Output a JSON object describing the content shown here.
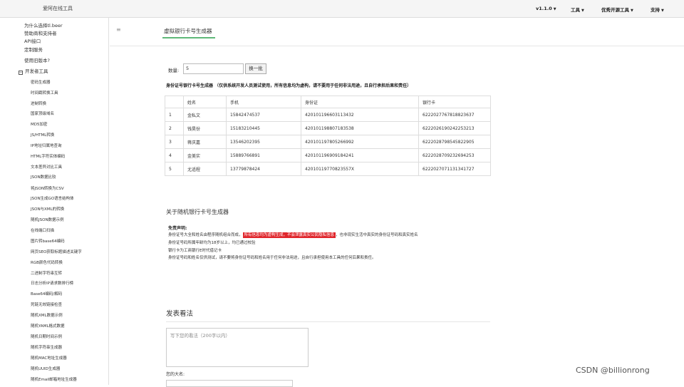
{
  "topbar": {
    "brand": "爱阿在线工具",
    "version": "v1.1.0",
    "tools": "工具",
    "open_source": "优秀开源工具",
    "support": "支持"
  },
  "sidebar": {
    "top_links": [
      "为什么选择tl.beer",
      "赞助商和支持者",
      "API接口",
      "定制服务",
      "使用旧版本?"
    ],
    "group_label": "开发者工具",
    "items": [
      "密码生成器",
      "时间戳转换工具",
      "进制转换",
      "国家顶级域名",
      "MD5加密",
      "JS/HTML转换",
      "IP地址归属地查询",
      "HTML字符实体编码",
      "文本差异对比工具",
      "JSON数据比较",
      "将JSON转换为CSV",
      "JSON生成GO语言结构体",
      "JSON与XML的转换",
      "随机JSON数据示例",
      "在线端口扫描",
      "图片转base64编码",
      "网页SEO获取标题描述关键字",
      "RGB颜色代码转换",
      "二进制字符串互转",
      "日志分析IP请求数排行榜",
      "Base64编码/解码",
      "死链无效链接检查",
      "随机XML数据示例",
      "随机YAML格式数据",
      "随机日期时间示例",
      "随机字符串生成器",
      "随机MAC地址生成器",
      "随机UUID生成器",
      "随机Email邮箱地址生成器"
    ]
  },
  "main": {
    "tab_label": "虚拟银行卡号生成器",
    "count_label": "数量:",
    "count_value": "5",
    "refresh_label": "换一批",
    "notice": "身份证号银行卡号生成器 （仅供系统开发人员测试使用，所有信息均为虚构，请不要用于任何非法用途，且自行承担后果和责任）",
    "table": {
      "headers": [
        "",
        "姓名",
        "手机",
        "身份证",
        "银行卡"
      ],
      "rows": [
        [
          "1",
          "金私文",
          "15842474537",
          "420101196603113432",
          "6222027767818823637"
        ],
        [
          "2",
          "钱昊份",
          "15183210445",
          "420101198807183538",
          "6222026190242253213"
        ],
        [
          "3",
          "蒋庆嘉",
          "13546202395",
          "420101197805266992",
          "6222028798545822905"
        ],
        [
          "4",
          "金美实",
          "15889766891",
          "420101196909184241",
          "6222028709232694253"
        ],
        [
          "5",
          "尤适程",
          "13779878424",
          "420101197708235​57X",
          "6222027071131341727"
        ]
      ]
    },
    "about_title": "关于随机银行卡号生成器",
    "disclaimer_title": "免责声明:",
    "disclaimer_line1_pre": "身份证号大全和姓名由程序随机组合而成，",
    "disclaimer_line1_hl": "所有信息均为虚构生成，不会泄露真实公民隐私信息",
    "disclaimer_line1_post": "，也非现实生活中真实的身份证号码和真实姓名",
    "disclaimer_line2": "身份证号码所属年龄均为18岁以上，均已通过校验",
    "disclaimer_line3": "银行卡为工商银行E时代借记卡",
    "disclaimer_line4": "身份证号码和姓名仅供测试，请不要将身份证号码和姓名用于任何非法用途，且自行承担使用本工具的任何后果和责任。",
    "comment_title": "发表看法",
    "comment_placeholder": "写下您的看法（200字以内）",
    "name_label": "您的大名:"
  },
  "watermark": "CSDN @billionrong"
}
